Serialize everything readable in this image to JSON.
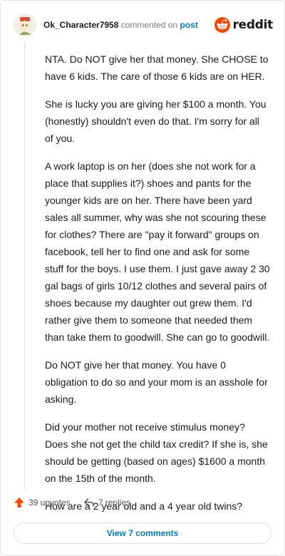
{
  "comment": {
    "author": "Ok_Character7958",
    "action_text": "commented on",
    "post_link": "post",
    "brand": "reddit",
    "paragraphs": [
      "NTA. Do NOT give her that money. She CHOSE to have 6 kids. The care of those 6 kids are on HER.",
      "She is lucky you are giving her $100 a month. You (honestly) shouldn't even do that. I'm sorry for all of you.",
      "A work laptop is on her (does she not work for a place that supplies it?) shoes and pants for the younger kids are on her. There have been yard sales all summer, why was she not scouring these for clothes? There are \"pay it forward\" groups on facebook, tell her to find one and ask for some stuff for the boys. I use them. I just gave away 2 30 gal bags of girls 10/12 clothes and several pairs of shoes because my daughter out grew them. I'd rather give them to someone that needed them than take them to goodwill. She can go to goodwill.",
      "Do NOT give her that money. You have 0 obligation to do so and your mom is an asshole for asking.",
      "Did your mother not receive stimulus money? Does she not get the child tax credit? If she is, she should be getting (based on ages) $1600 a month on the 15th of the month.",
      "How are a 2 year old and a 4 year old twins?"
    ],
    "upvotes_label": "39 upvotes",
    "replies_label": "7 replies",
    "view_comments_label": "View 7 comments"
  },
  "colors": {
    "accent_blue": "#0079d3",
    "upvote_orange": "#ff4500",
    "text": "#1a1a1b",
    "muted": "#787c7e"
  }
}
